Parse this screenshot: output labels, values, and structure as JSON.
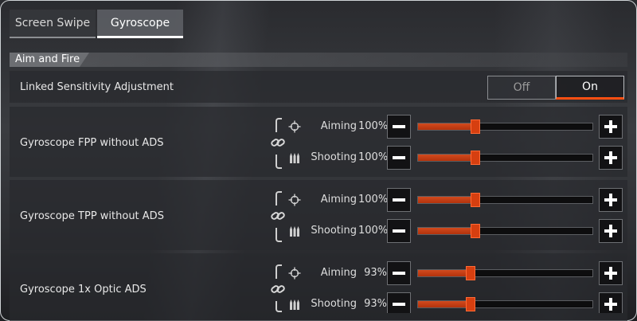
{
  "tabs": [
    {
      "label": "Screen Swipe",
      "active": false
    },
    {
      "label": "Gyroscope",
      "active": true
    }
  ],
  "section": {
    "label": "Aim and Fire"
  },
  "linked": {
    "label": "Linked Sensitivity Adjustment",
    "off_label": "Off",
    "on_label": "On",
    "selected": "On"
  },
  "settings": [
    {
      "label": "Gyroscope FPP without ADS",
      "rows": [
        {
          "name": "Aiming",
          "value_text": "100%",
          "fraction": 0.33
        },
        {
          "name": "Shooting",
          "value_text": "100%",
          "fraction": 0.33
        }
      ]
    },
    {
      "label": "Gyroscope TPP without ADS",
      "rows": [
        {
          "name": "Aiming",
          "value_text": "100%",
          "fraction": 0.33
        },
        {
          "name": "Shooting",
          "value_text": "100%",
          "fraction": 0.33
        }
      ]
    },
    {
      "label": "Gyroscope 1x Optic ADS",
      "rows": [
        {
          "name": "Aiming",
          "value_text": "93%",
          "fraction": 0.3
        },
        {
          "name": "Shooting",
          "value_text": "93%",
          "fraction": 0.3
        }
      ]
    }
  ],
  "icons": {
    "aim": "crosshair-icon",
    "shoot": "bullets-icon",
    "link": "link-icon",
    "minus": "minus-icon",
    "plus": "plus-icon"
  },
  "colors": {
    "accent": "#d63f10",
    "toggle_on_underline": "#ff4f12"
  }
}
